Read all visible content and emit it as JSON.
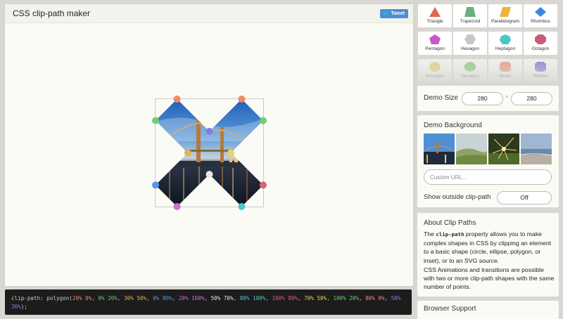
{
  "app": {
    "title": "CSS clip-path maker",
    "tweet_label": "Tweet"
  },
  "shapes": [
    {
      "name": "Triangle",
      "color": "#e0664f"
    },
    {
      "name": "Trapezoid",
      "color": "#68b27a"
    },
    {
      "name": "Parallelogram",
      "color": "#f2b23c"
    },
    {
      "name": "Rhombus",
      "color": "#3e86e0"
    },
    {
      "name": "Pentagon",
      "color": "#c758c9"
    },
    {
      "name": "Hexagon",
      "color": "#c7c7c7"
    },
    {
      "name": "Heptagon",
      "color": "#4cc6c6"
    },
    {
      "name": "Octagon",
      "color": "#cc5a79"
    },
    {
      "name": "Nonagon",
      "color": "#e6d56a"
    },
    {
      "name": "Decagon",
      "color": "#6fce70"
    },
    {
      "name": "Bevel",
      "color": "#ee8a6a"
    },
    {
      "name": "Rabbet",
      "color": "#6d63d4"
    }
  ],
  "clip_path_code": {
    "prefix": "clip-path: polygon(",
    "points": [
      {
        "text": "20% 0%",
        "color": "#ee8a6a"
      },
      {
        "text": "0% 20%",
        "color": "#6fce70"
      },
      {
        "text": "30% 50%",
        "color": "#e0b25a"
      },
      {
        "text": "0% 80%",
        "color": "#5b96e6"
      },
      {
        "text": "20% 100%",
        "color": "#cf6fcf"
      },
      {
        "text": "50% 70%",
        "color": "#e8e8e8"
      },
      {
        "text": "80% 100%",
        "color": "#4cc6c6"
      },
      {
        "text": "100% 80%",
        "color": "#d9617f"
      },
      {
        "text": "70% 50%",
        "color": "#e6d56a"
      },
      {
        "text": "100% 20%",
        "color": "#6fce70"
      },
      {
        "text": "80% 0%",
        "color": "#ee8a6a"
      },
      {
        "text": "50% 30%",
        "color": "#8a7ce0"
      }
    ],
    "suffix": ");"
  },
  "demo_size": {
    "label": "Demo Size",
    "width": "280",
    "separator": "×",
    "height": "280"
  },
  "demo_background": {
    "label": "Demo Background",
    "url_placeholder": "Custom URL...",
    "outside_label": "Show outside clip-path",
    "outside_value": "Off"
  },
  "about": {
    "title": "About Clip Paths",
    "p1_before": "The ",
    "p1_code": "clip-path",
    "p1_after": " property allows you to make complex shapes in CSS by clipping an element to a basic shape (circle, ellipse, polygon, or inset), or to an SVG source.",
    "p2": "CSS Animations and transitions are possible with two or more clip-path shapes with the same number of points."
  },
  "browser_support": {
    "title": "Browser Support"
  }
}
